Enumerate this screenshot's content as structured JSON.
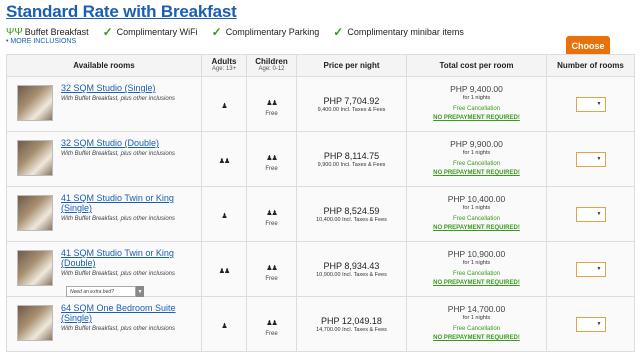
{
  "title": "Standard Rate with Breakfast",
  "inclusions": [
    "Buffet Breakfast",
    "Complimentary WiFi",
    "Complimentary Parking",
    "Complimentary minibar items"
  ],
  "more_inclusions": "• MORE INCLUSIONS",
  "choose_label": "Choose",
  "headers": {
    "rooms": "Available rooms",
    "adults": "Adults",
    "adults_sub": "Age: 13+",
    "children": "Children",
    "children_sub": "Age: 0-12",
    "price": "Price per night",
    "total": "Total cost per room",
    "number": "Number of rooms"
  },
  "rows": [
    {
      "name": "32 SQM Studio (Single)",
      "sub": "With Buffet Breakfast, plus other inclusions",
      "adults": "♟",
      "children": "♟♟",
      "children_free": "Free",
      "price": "PHP 7,704.92",
      "price_tax": "9,400.00 Incl. Taxes & Fees",
      "total": "PHP 9,400.00",
      "nights": "for 1 nights",
      "fc": "Free Cancellation",
      "np": "NO PREPAYMENT REQUIRED!"
    },
    {
      "name": "32 SQM Studio (Double)",
      "sub": "With Buffet Breakfast, plus other inclusions",
      "adults": "♟♟",
      "children": "♟♟",
      "children_free": "Free",
      "price": "PHP 8,114.75",
      "price_tax": "9,900.00 Incl. Taxes & Fees",
      "total": "PHP 9,900.00",
      "nights": "for 1 nights",
      "fc": "Free Cancellation",
      "np": "NO PREPAYMENT REQUIRED!"
    },
    {
      "name": "41 SQM Studio Twin or King (Single)",
      "sub": "With Buffet Breakfast, plus other inclusions",
      "adults": "♟",
      "children": "♟♟",
      "children_free": "Free",
      "price": "PHP 8,524.59",
      "price_tax": "10,400.00 Incl. Taxes & Fees",
      "total": "PHP 10,400.00",
      "nights": "for 1 nights",
      "fc": "Free Cancellation",
      "np": "NO PREPAYMENT REQUIRED!"
    },
    {
      "name": "41 SQM Studio Twin or King (Double)",
      "sub": "With Buffet Breakfast, plus other inclusions",
      "adults": "♟♟",
      "children": "♟♟",
      "children_free": "Free",
      "price": "PHP 8,934.43",
      "price_tax": "10,900.00 Incl. Taxes & Fees",
      "total": "PHP 10,900.00",
      "nights": "for 1 nights",
      "fc": "Free Cancellation",
      "np": "NO PREPAYMENT REQUIRED!",
      "extra_bed": "Need an extra bed?"
    },
    {
      "name": "64 SQM One Bedroom Suite (Single)",
      "sub": "With Buffet Breakfast, plus other inclusions",
      "adults": "♟",
      "children": "♟♟",
      "children_free": "Free",
      "price": "PHP 12,049.18",
      "price_tax": "14,700.00 Incl. Taxes & Fees",
      "total": "PHP 14,700.00",
      "nights": "for 1 nights",
      "fc": "Free Cancellation",
      "np": "NO PREPAYMENT REQUIRED!"
    }
  ],
  "colors": {
    "accent": "#1a5fb4",
    "green": "#3a9a1e",
    "orange": "#e8710a"
  }
}
